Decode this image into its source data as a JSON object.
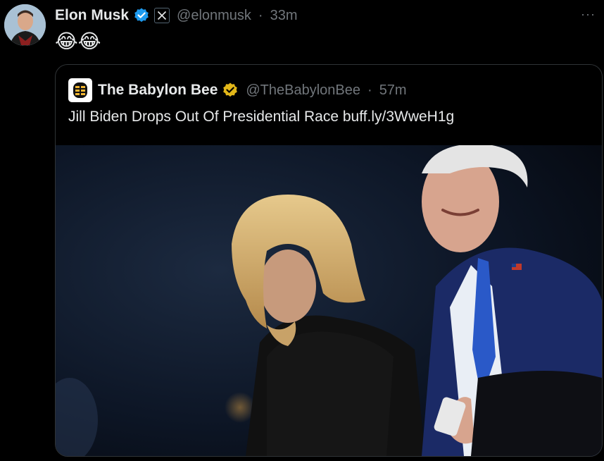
{
  "tweet": {
    "author_name": "Elon Musk",
    "handle": "@elonmusk",
    "separator": "·",
    "time": "33m",
    "text": "😂😂",
    "more_label": "···"
  },
  "quoted": {
    "author_name": "The Babylon Bee",
    "handle": "@TheBabylonBee",
    "separator": "·",
    "time": "57m",
    "text": "Jill Biden Drops Out Of Presidential Race buff.ly/3WweH1g"
  },
  "icons": {
    "verified": "verified-badge-icon",
    "affiliate": "x-logo-icon",
    "gold_verified": "gold-verified-badge-icon",
    "more": "more-horizontal-icon"
  },
  "colors": {
    "background": "#000000",
    "text": "#e7e9ea",
    "muted": "#71767b",
    "verified_blue": "#1d9bf0",
    "verified_gold": "#e2b719",
    "border": "#2f3336"
  }
}
